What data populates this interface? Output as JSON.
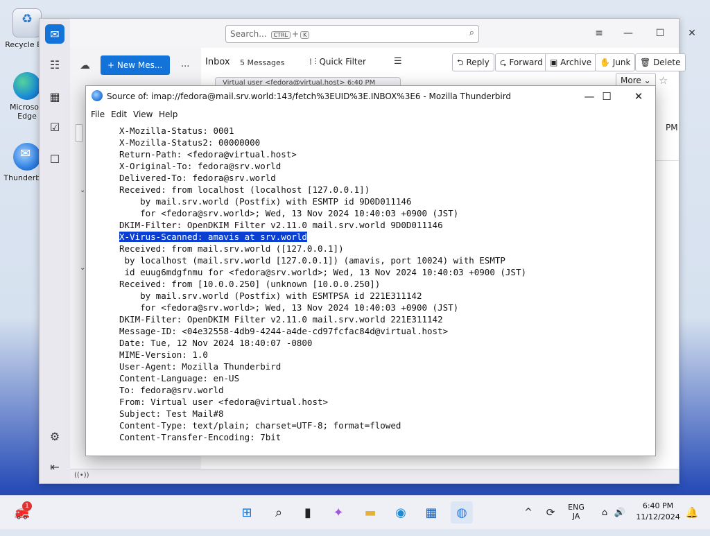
{
  "desktop": {
    "icons": [
      {
        "label": "Recycle Bin"
      },
      {
        "label": "Microsoft Edge"
      },
      {
        "label": "Thunderbird"
      }
    ]
  },
  "thunderbird": {
    "search_placeholder": "Search...",
    "search_shortcut_1": "CTRL",
    "search_shortcut_plus": "+",
    "search_shortcut_2": "K",
    "new_message": "New Mes...",
    "more_dots": "...",
    "folder": "Inbox",
    "message_count": "5 Messages",
    "quick_filter": "Quick Filter",
    "thread_row_preview": "Virtual user <fedora@virtual.host>   6:40 PM",
    "time_fragment": "PM",
    "buttons": {
      "reply": "Reply",
      "forward": "Forward",
      "archive": "Archive",
      "junk": "Junk",
      "delete": "Delete",
      "more": "More"
    }
  },
  "source_window": {
    "title": "Source of: imap://fedora@mail.srv.world:143/fetch%3EUID%3E.INBOX%3E6 - Mozilla Thunderbird",
    "menu": {
      "file": "File",
      "edit": "Edit",
      "view": "View",
      "help": "Help"
    },
    "lines_before": [
      "X-Mozilla-Status: 0001",
      "X-Mozilla-Status2: 00000000",
      "Return-Path: <fedora@virtual.host>",
      "X-Original-To: fedora@srv.world",
      "Delivered-To: fedora@srv.world",
      "Received: from localhost (localhost [127.0.0.1])",
      "    by mail.srv.world (Postfix) with ESMTP id 9D0D011146",
      "    for <fedora@srv.world>; Wed, 13 Nov 2024 10:40:03 +0900 (JST)",
      "DKIM-Filter: OpenDKIM Filter v2.11.0 mail.srv.world 9D0D011146"
    ],
    "highlighted_line": "X-Virus-Scanned: amavis at srv.world",
    "lines_after": [
      "Received: from mail.srv.world ([127.0.0.1])",
      " by localhost (mail.srv.world [127.0.0.1]) (amavis, port 10024) with ESMTP",
      " id euug6mdgfnmu for <fedora@srv.world>; Wed, 13 Nov 2024 10:40:03 +0900 (JST)",
      "Received: from [10.0.0.250] (unknown [10.0.0.250])",
      "    by mail.srv.world (Postfix) with ESMTPSA id 221E311142",
      "    for <fedora@srv.world>; Wed, 13 Nov 2024 10:40:03 +0900 (JST)",
      "DKIM-Filter: OpenDKIM Filter v2.11.0 mail.srv.world 221E311142",
      "Message-ID: <04e32558-4db9-4244-a4de-cd97fcfac84d@virtual.host>",
      "Date: Tue, 12 Nov 2024 18:40:07 -0800",
      "MIME-Version: 1.0",
      "User-Agent: Mozilla Thunderbird",
      "Content-Language: en-US",
      "To: fedora@srv.world",
      "From: Virtual user <fedora@virtual.host>",
      "Subject: Test Mail#8",
      "Content-Type: text/plain; charset=UTF-8; format=flowed",
      "Content-Transfer-Encoding: 7bit"
    ]
  },
  "taskbar": {
    "notification_badge": "1",
    "lang_top": "ENG",
    "lang_bottom": "JA",
    "time": "6:40 PM",
    "date": "11/12/2024"
  },
  "colors": {
    "accent": "#1373d9",
    "selection": "#0a3fd1"
  }
}
